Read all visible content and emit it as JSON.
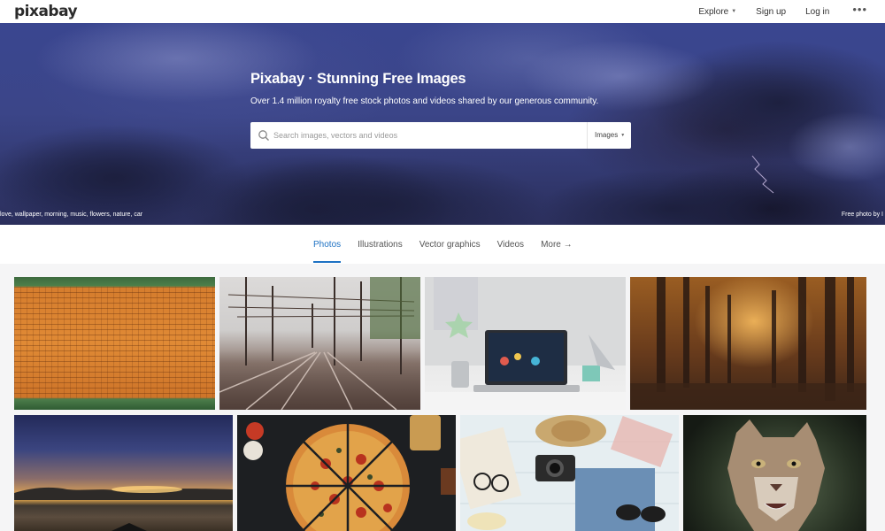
{
  "header": {
    "logo": "pixabay",
    "nav": [
      {
        "label": "Explore",
        "has_caret": true
      },
      {
        "label": "Sign up"
      },
      {
        "label": "Log in"
      }
    ],
    "more_icon": "more-horizontal-icon"
  },
  "hero": {
    "title": "Pixabay · Stunning Free Images",
    "subtitle": "Over 1.4 million royalty free stock photos and videos shared by our generous community.",
    "search": {
      "placeholder": "Search images, vectors and videos",
      "type_label": "Images",
      "icon": "search-icon"
    },
    "tags": "love, wallpaper, morning, music, flowers, nature, car",
    "credit": "Free photo by I"
  },
  "tabs": [
    {
      "label": "Photos",
      "active": true
    },
    {
      "label": "Illustrations"
    },
    {
      "label": "Vector graphics"
    },
    {
      "label": "Videos"
    },
    {
      "label": "More →"
    }
  ],
  "gallery": [
    {
      "subject": "roof-tiles"
    },
    {
      "subject": "railway-tracks"
    },
    {
      "subject": "laptop-desk"
    },
    {
      "subject": "foggy-forest"
    },
    {
      "subject": "sunset-lake"
    },
    {
      "subject": "pizza"
    },
    {
      "subject": "travel-flatlay"
    },
    {
      "subject": "cougar"
    }
  ],
  "colors": {
    "accent": "#1d71c3",
    "header_bg": "#ffffff",
    "page_bg": "#f5f5f6"
  }
}
